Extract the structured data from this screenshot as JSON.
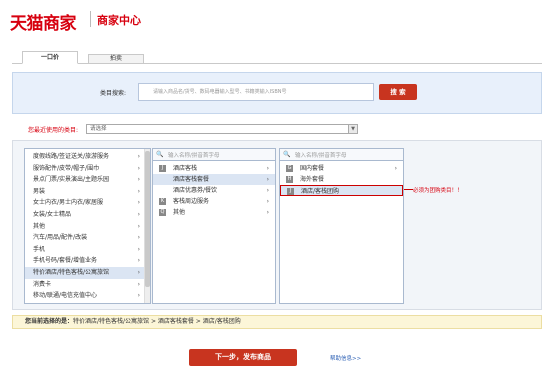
{
  "header": {
    "logo": "天猫商家",
    "subtitle": "商家中心"
  },
  "tabs": [
    {
      "label": "一口价"
    },
    {
      "label": "拍卖"
    }
  ],
  "search": {
    "label": "类目搜索:",
    "placeholder": "请输入商品名/货号、数码电器输入型号、书籍类输入ISBN号",
    "button": "搜 索"
  },
  "recent": {
    "label": "您最近使用的类目:",
    "value": "请选择",
    "arrow": "▼"
  },
  "col1": {
    "items": [
      {
        "label": "度假线路/签证送关/旅游服务"
      },
      {
        "label": "服饰配件/皮带/帽子/围巾"
      },
      {
        "label": "景点门票/实景演出/主题乐园"
      },
      {
        "label": "男装"
      },
      {
        "label": "女士内衣/男士内衣/家居服"
      },
      {
        "label": "女装/女士精品"
      },
      {
        "label": "其他"
      },
      {
        "label": "汽车/用品/配件/改装"
      },
      {
        "label": "手机"
      },
      {
        "label": "手机号码/套餐/增值业务"
      },
      {
        "label": "特价酒店/特色客栈/公寓旅馆"
      },
      {
        "label": "消费卡"
      },
      {
        "label": "移动/联通/电信充值中心"
      }
    ]
  },
  "col2": {
    "search_icon": "🔍",
    "placeholder": "输入名称/拼音首字母",
    "items": [
      {
        "letter": "J",
        "label": "酒店客栈"
      },
      {
        "letter": "",
        "label": "酒店客栈套餐"
      },
      {
        "letter": "",
        "label": "酒店优惠券/餐饮"
      },
      {
        "letter": "K",
        "label": "客栈周边服务"
      },
      {
        "letter": "Q",
        "label": "其他"
      }
    ]
  },
  "col3": {
    "search_icon": "🔍",
    "placeholder": "输入名称/拼音首字母",
    "items": [
      {
        "letter": "G",
        "label": "国内套餐"
      },
      {
        "letter": "H",
        "label": "海外套餐"
      },
      {
        "letter": "J",
        "label": "酒店/客栈团购"
      }
    ]
  },
  "promo": "必须为团购类目！！",
  "chevron": "›",
  "selection": {
    "prefix": "您当前选择的是：",
    "path": "特价酒店/特色客栈/公寓旅馆 > 酒店客栈套餐 > 酒店/客栈团购"
  },
  "next_button": "下一步，发布商品",
  "help_link": "帮助信息>>"
}
